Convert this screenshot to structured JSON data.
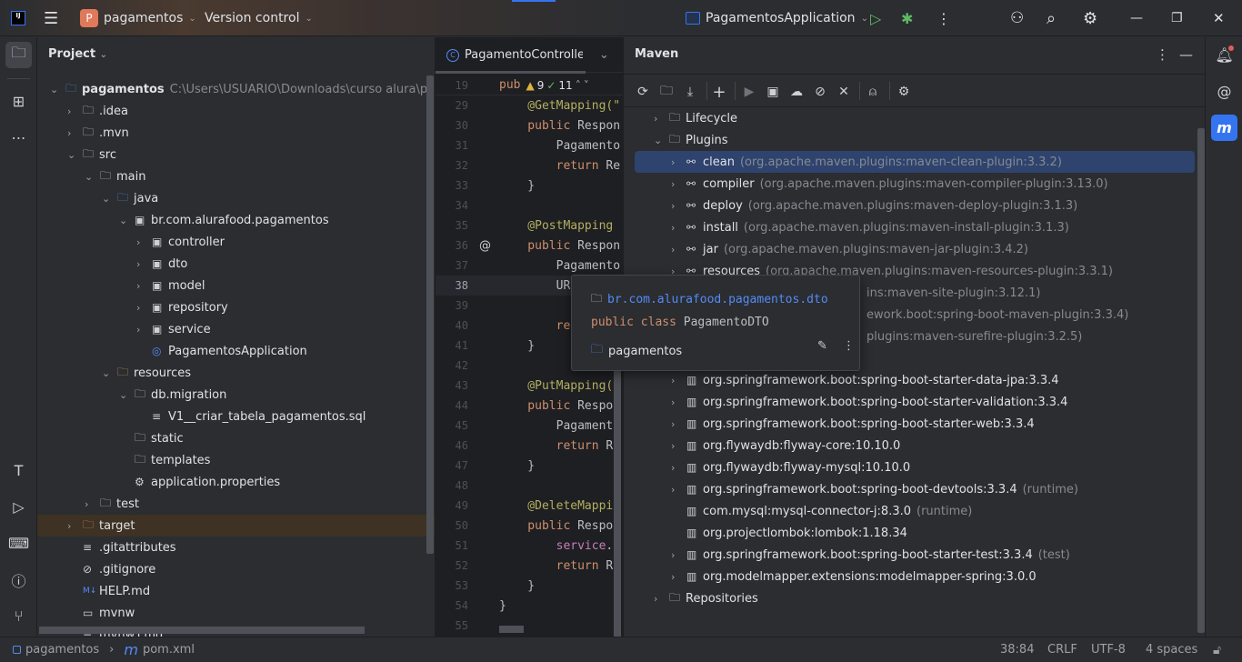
{
  "titlebar": {
    "project_initial": "P",
    "project": "pagamentos",
    "vcs": "Version control",
    "run_config": "PagamentosApplication"
  },
  "project_panel": {
    "title": "Project",
    "items": [
      {
        "level": 0,
        "label": "pagamentos",
        "suffix": "C:\\Users\\USUARIO\\Downloads\\curso alura\\paga",
        "chevron": "down",
        "icon": "module-folder",
        "bold": true
      },
      {
        "level": 1,
        "label": ".idea",
        "chevron": "right",
        "icon": "folder"
      },
      {
        "level": 1,
        "label": ".mvn",
        "chevron": "right",
        "icon": "folder"
      },
      {
        "level": 1,
        "label": "src",
        "chevron": "down",
        "icon": "folder"
      },
      {
        "level": 2,
        "label": "main",
        "chevron": "down",
        "icon": "folder"
      },
      {
        "level": 3,
        "label": "java",
        "chevron": "down",
        "icon": "source-folder"
      },
      {
        "level": 4,
        "label": "br.com.alurafood.pagamentos",
        "chevron": "down",
        "icon": "package"
      },
      {
        "level": 5,
        "label": "controller",
        "chevron": "right",
        "icon": "package"
      },
      {
        "level": 5,
        "label": "dto",
        "chevron": "right",
        "icon": "package"
      },
      {
        "level": 5,
        "label": "model",
        "chevron": "right",
        "icon": "package"
      },
      {
        "level": 5,
        "label": "repository",
        "chevron": "right",
        "icon": "package"
      },
      {
        "level": 5,
        "label": "service",
        "chevron": "right",
        "icon": "package"
      },
      {
        "level": 5,
        "label": "PagamentosApplication",
        "chevron": "none",
        "icon": "spring-class"
      },
      {
        "level": 3,
        "label": "resources",
        "chevron": "down",
        "icon": "resources-folder"
      },
      {
        "level": 4,
        "label": "db.migration",
        "chevron": "down",
        "icon": "folder"
      },
      {
        "level": 5,
        "label": "V1__criar_tabela_pagamentos.sql",
        "chevron": "none",
        "icon": "sql-file"
      },
      {
        "level": 4,
        "label": "static",
        "chevron": "none",
        "icon": "folder"
      },
      {
        "level": 4,
        "label": "templates",
        "chevron": "none",
        "icon": "folder"
      },
      {
        "level": 4,
        "label": "application.properties",
        "chevron": "none",
        "icon": "gear"
      },
      {
        "level": 2,
        "label": "test",
        "chevron": "right",
        "icon": "folder"
      },
      {
        "level": 1,
        "label": "target",
        "chevron": "right",
        "icon": "excluded-folder",
        "highlight": true
      },
      {
        "level": 1,
        "label": ".gitattributes",
        "chevron": "none",
        "icon": "text-file"
      },
      {
        "level": 1,
        "label": ".gitignore",
        "chevron": "none",
        "icon": "ignore-file"
      },
      {
        "level": 1,
        "label": "HELP.md",
        "chevron": "none",
        "icon": "markdown-file"
      },
      {
        "level": 1,
        "label": "mvnw",
        "chevron": "none",
        "icon": "shell-file"
      },
      {
        "level": 1,
        "label": "mvnw.cmd",
        "chevron": "none",
        "icon": "text-file"
      }
    ]
  },
  "editor": {
    "tab": "PagamentoController",
    "sticky": {
      "line": "19",
      "code": "pub",
      "warnings": "9",
      "checks": "11"
    },
    "lines": [
      {
        "n": "29",
        "t": [
          [
            "an",
            "    @GetMapping(\""
          ]
        ]
      },
      {
        "n": "30",
        "t": [
          [
            "kw",
            "    public "
          ],
          [
            "pl",
            "Respon"
          ]
        ]
      },
      {
        "n": "31",
        "t": [
          [
            "pl",
            "        Pagamento"
          ]
        ]
      },
      {
        "n": "32",
        "t": [
          [
            "kw",
            "        return "
          ],
          [
            "pl",
            "Re"
          ]
        ]
      },
      {
        "n": "33",
        "t": [
          [
            "pl",
            "    }"
          ]
        ]
      },
      {
        "n": "34",
        "t": []
      },
      {
        "n": "35",
        "t": [
          [
            "an",
            "    @PostMapping"
          ]
        ]
      },
      {
        "n": "36",
        "t": [
          [
            "kw",
            "    public "
          ],
          [
            "pl",
            "Respon"
          ]
        ],
        "gutter": "@"
      },
      {
        "n": "37",
        "t": [
          [
            "pl",
            "        Pagamento"
          ]
        ]
      },
      {
        "n": "38",
        "t": [
          [
            "pl",
            "        UR"
          ]
        ],
        "current": true
      },
      {
        "n": "39",
        "t": []
      },
      {
        "n": "40",
        "t": [
          [
            "kw",
            "        re"
          ]
        ]
      },
      {
        "n": "41",
        "t": [
          [
            "pl",
            "    }"
          ]
        ]
      },
      {
        "n": "42",
        "t": []
      },
      {
        "n": "43",
        "t": [
          [
            "an",
            "    @PutMapping(\""
          ]
        ]
      },
      {
        "n": "44",
        "t": [
          [
            "kw",
            "    public "
          ],
          [
            "pl",
            "Respon"
          ]
        ]
      },
      {
        "n": "45",
        "t": [
          [
            "pl",
            "        Pagamento"
          ]
        ]
      },
      {
        "n": "46",
        "t": [
          [
            "kw",
            "        return "
          ],
          [
            "pl",
            "Re"
          ]
        ]
      },
      {
        "n": "47",
        "t": [
          [
            "pl",
            "    }"
          ]
        ]
      },
      {
        "n": "48",
        "t": []
      },
      {
        "n": "49",
        "t": [
          [
            "an",
            "    @DeleteMappin"
          ]
        ]
      },
      {
        "n": "50",
        "t": [
          [
            "kw",
            "    public "
          ],
          [
            "pl",
            "Respon"
          ]
        ]
      },
      {
        "n": "51",
        "t": [
          [
            "pu",
            "        service"
          ],
          [
            "pl",
            ".e"
          ]
        ]
      },
      {
        "n": "52",
        "t": [
          [
            "kw",
            "        return "
          ],
          [
            "pl",
            "Re"
          ]
        ]
      },
      {
        "n": "53",
        "t": [
          [
            "pl",
            "    }"
          ]
        ]
      },
      {
        "n": "54",
        "t": [
          [
            "pl",
            "}"
          ]
        ]
      },
      {
        "n": "55",
        "t": []
      }
    ]
  },
  "maven": {
    "title": "Maven",
    "rows": [
      {
        "level": 0,
        "label": "Lifecycle",
        "chevron": "right",
        "icon": "maven-folder"
      },
      {
        "level": 0,
        "label": "Plugins",
        "chevron": "down",
        "icon": "maven-folder"
      },
      {
        "level": 1,
        "label": "clean",
        "suffix": "(org.apache.maven.plugins:maven-clean-plugin:3.3.2)",
        "chevron": "right",
        "icon": "maven-plugin",
        "selected": true
      },
      {
        "level": 1,
        "label": "compiler",
        "suffix": "(org.apache.maven.plugins:maven-compiler-plugin:3.13.0)",
        "chevron": "right",
        "icon": "maven-plugin"
      },
      {
        "level": 1,
        "label": "deploy",
        "suffix": "(org.apache.maven.plugins:maven-deploy-plugin:3.1.3)",
        "chevron": "right",
        "icon": "maven-plugin"
      },
      {
        "level": 1,
        "label": "install",
        "suffix": "(org.apache.maven.plugins:maven-install-plugin:3.1.3)",
        "chevron": "right",
        "icon": "maven-plugin"
      },
      {
        "level": 1,
        "label": "jar",
        "suffix": "(org.apache.maven.plugins:maven-jar-plugin:3.4.2)",
        "chevron": "right",
        "icon": "maven-plugin"
      },
      {
        "level": 1,
        "label": "resources",
        "suffix": "(org.apache.maven.plugins:maven-resources-plugin:3.3.1)",
        "chevron": "right",
        "icon": "maven-plugin"
      },
      {
        "fragment": "ins:maven-site-plugin:3.12.1)"
      },
      {
        "fragment": "ework.boot:spring-boot-maven-plugin:3.3.4)"
      },
      {
        "fragment": "plugins:maven-surefire-plugin:3.2.5)"
      },
      {
        "hidden": true
      },
      {
        "level": 1,
        "label": "org.springframework.boot:spring-boot-starter-data-jpa:3.3.4",
        "chevron": "right",
        "icon": "library"
      },
      {
        "level": 1,
        "label": "org.springframework.boot:spring-boot-starter-validation:3.3.4",
        "chevron": "right",
        "icon": "library"
      },
      {
        "level": 1,
        "label": "org.springframework.boot:spring-boot-starter-web:3.3.4",
        "chevron": "right",
        "icon": "library"
      },
      {
        "level": 1,
        "label": "org.flywaydb:flyway-core:10.10.0",
        "chevron": "right",
        "icon": "library"
      },
      {
        "level": 1,
        "label": "org.flywaydb:flyway-mysql:10.10.0",
        "chevron": "right",
        "icon": "library"
      },
      {
        "level": 1,
        "label": "org.springframework.boot:spring-boot-devtools:3.3.4",
        "suffix": "(runtime)",
        "chevron": "right",
        "icon": "library"
      },
      {
        "level": 1,
        "label": "com.mysql:mysql-connector-j:8.3.0",
        "suffix": "(runtime)",
        "chevron": "none",
        "icon": "library"
      },
      {
        "level": 1,
        "label": "org.projectlombok:lombok:1.18.34",
        "chevron": "none",
        "icon": "library"
      },
      {
        "level": 1,
        "label": "org.springframework.boot:spring-boot-starter-test:3.3.4",
        "suffix": "(test)",
        "chevron": "right",
        "icon": "library"
      },
      {
        "level": 1,
        "label": "org.modelmapper.extensions:modelmapper-spring:3.0.0",
        "chevron": "right",
        "icon": "library"
      },
      {
        "level": 0,
        "label": "Repositories",
        "chevron": "right",
        "icon": "repositories-folder"
      }
    ]
  },
  "popup": {
    "package": "br.com.alurafood.pagamentos.dto",
    "declaration_kw": "public class ",
    "declaration_name": "PagamentoDTO",
    "module": "pagamentos"
  },
  "statusbar": {
    "crumb_project": "pagamentos",
    "crumb_file": "pom.xml",
    "position": "38:84",
    "line_sep": "CRLF",
    "encoding": "UTF-8",
    "indent": "4 spaces"
  },
  "colors": {
    "accent": "#3574f0",
    "selection": "#2e436e",
    "project_badge": "#e0785a",
    "run": "#5fb865"
  }
}
